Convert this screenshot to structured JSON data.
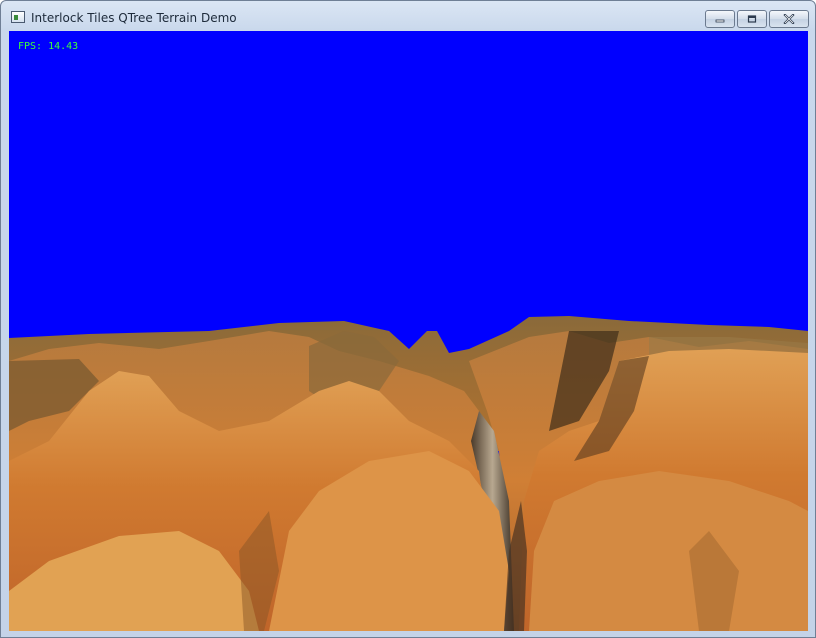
{
  "window": {
    "title": "Interlock Tiles QTree Terrain Demo",
    "minimize_icon": "minimize-icon",
    "maximize_icon": "maximize-icon",
    "close_icon": "close-icon",
    "app_icon": "app-window-icon"
  },
  "scene": {
    "fps_text": "FPS: 14.43",
    "sky_color": "#0000ff",
    "terrain_color": "#c8742e",
    "fps_text_color": "#3cff3c"
  }
}
